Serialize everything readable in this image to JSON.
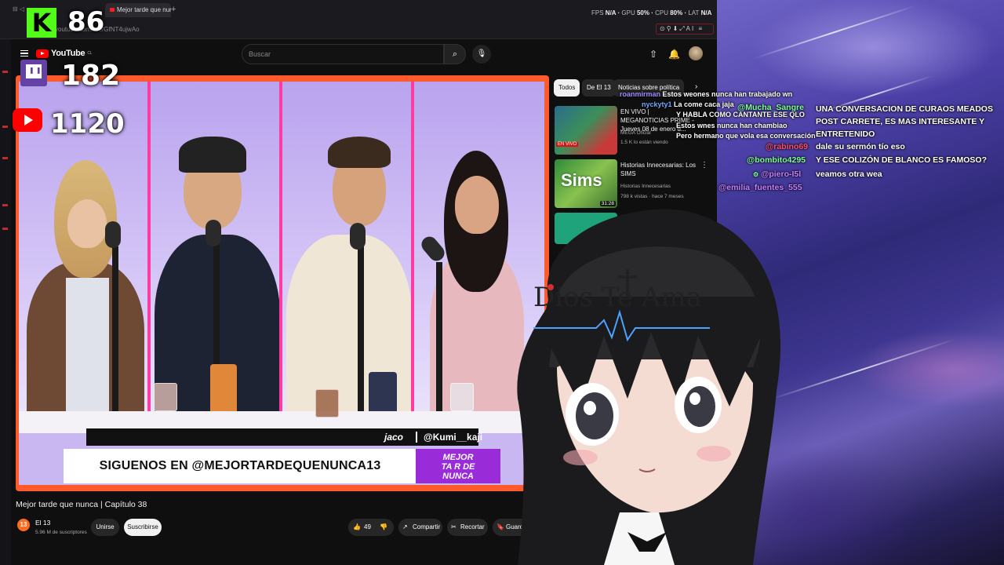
{
  "browser": {
    "tab_title": "Mejor tarde que nunca",
    "new_tab": "+",
    "url": "youtube.com/live/GfNT4ujwAo",
    "perf": {
      "fps_label": "FPS",
      "fps": "N/A",
      "gpu_label": "GPU",
      "gpu": "50%",
      "cpu_label": "CPU",
      "cpu": "80%",
      "lat_label": "LAT",
      "lat": "N/A"
    },
    "toolbar_icons": "⊙⚲⬇⤢AI ≡"
  },
  "youtube": {
    "logo": "YouTube",
    "logo_region": "CL",
    "search_placeholder": "Buscar",
    "search_icon": "search-icon",
    "video_title": "Mejor tarde que nunca | Capítulo 38",
    "channel": {
      "avatar_text": "13",
      "name": "El 13",
      "subs": "5.96 M de suscriptores"
    },
    "join_label": "Unirse",
    "subscribe_label": "Suscribirse",
    "like_count": "49",
    "share_label": "Compartir",
    "clip_label": "Recortar",
    "save_label": "Guardar",
    "more_label": "⋯"
  },
  "video_overlay": {
    "name1": "jaco",
    "name2": "@Kumi__kaji",
    "banner": "SIGUENOS EN @MEJORTARDEQUENUNCA13",
    "show_logo_lines": [
      "MEJOR",
      "TA R DE",
      "NUNCA"
    ]
  },
  "recommendations": {
    "chips": [
      "Todos",
      "De El 13",
      "Noticias sobre política"
    ],
    "items": [
      {
        "title": "EN VIVO | MEGANOTICIAS PRIME - Jueves 08 de enero d...",
        "channel": "MEGA Oficial",
        "meta": "1.5 K lo están viendo",
        "badge": "EN VIVO"
      },
      {
        "title": "Historias Innecesarias: Los SIMS",
        "channel": "Historias Innecesarias",
        "meta": "798 k vistas · hace 7 meses",
        "duration": "31:28"
      }
    ]
  },
  "counters": {
    "kick": "86",
    "twitch": "182",
    "youtube": "1120",
    "kick_letter": "K"
  },
  "chat": [
    {
      "user": "roanmirman",
      "msg": "Estos weones nunca han trabajado wn",
      "color": "#9b8cff"
    },
    {
      "user": "nyckyty1",
      "msg": "La come caca jaja",
      "color": "#6ea8ff"
    },
    {
      "user": "",
      "msg": "Y HABLA COMO CANTANTE ESE QLO",
      "color": "#ffffff"
    },
    {
      "user": "",
      "msg": "Estos wnes nunca han chambiao",
      "color": "#ff5c5c"
    },
    {
      "user": "",
      "msg": "Pero hermano que vola esa conversación",
      "color": "#5c7cff"
    },
    {
      "user": "@Mucha_Sangre",
      "msg": "UNA CONVERSACION DE CURAOS MEADOS POST CARRETE, ES MAS INTERESANTE Y ENTRETENIDO",
      "color": "#7cff9a"
    },
    {
      "user": "@rabino69",
      "msg": "dale su sermón tío eso",
      "color": "#ff4d6d"
    },
    {
      "user": "@bombito4295",
      "msg": "Y ESE COLIZÓN DE BLANCO ES FAMOSO?",
      "color": "#7cff9a"
    },
    {
      "user": "@piero-I5l",
      "msg": "veamos otra wea",
      "color": "#c77dff"
    },
    {
      "user": "@emilia_fuentes_555",
      "msg": "",
      "color": "#c77dff"
    }
  ],
  "avatar_shirt_text": "Dios Te Ama"
}
